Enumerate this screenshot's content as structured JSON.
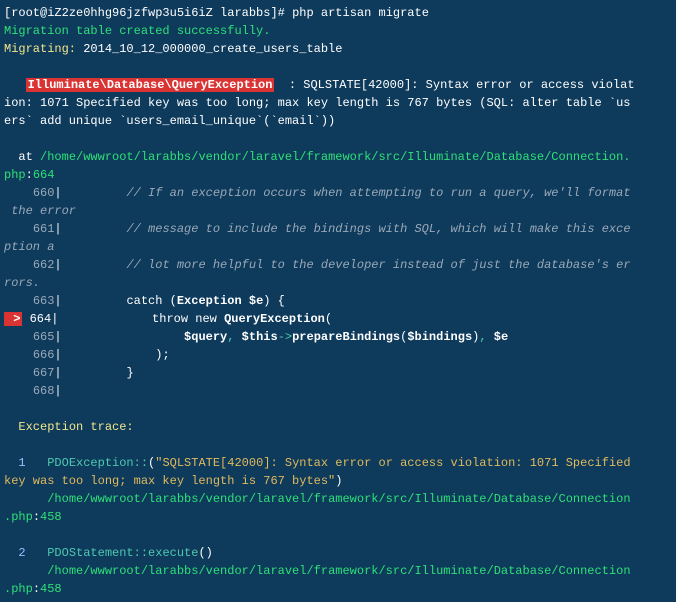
{
  "prompt": {
    "user_host": "root@iZ2ze0hhg96jzfwp3u5i6iZ",
    "path": "larabbs",
    "command": "php artisan migrate"
  },
  "messages": {
    "migration_created": "Migration table created successfully.",
    "migrating_label": "Migrating:",
    "migrating_file": "2014_10_12_000000_create_users_table"
  },
  "error": {
    "exception_class": "Illuminate\\Database\\QueryException",
    "colon": ":",
    "sqlstate_line1": "SQLSTATE[42000]: Syntax error or access violat",
    "sqlstate_line2": "ion: 1071 Specified key was too long; max key length is 767 bytes (SQL: alter table `us",
    "sqlstate_line3": "ers` add unique `users_email_unique`(`email`))"
  },
  "location": {
    "at": "at",
    "path": "/home/wwwroot/larabbs/vendor/laravel/framework/src/Illuminate/Database/Connection.",
    "php": "php",
    "line": "664"
  },
  "code": {
    "l660": {
      "num": "660",
      "text": "// If an exception occurs when attempting to run a query, we'll format"
    },
    "l660b": " the error",
    "l661": {
      "num": "661",
      "text": "// message to include the bindings with SQL, which will make this exce"
    },
    "l661b": "ption a",
    "l662": {
      "num": "662",
      "text": "// lot more helpful to the developer instead of just the database's er"
    },
    "l662b": "rors.",
    "l663": {
      "num": "663",
      "catch": "catch",
      "lparen": "(",
      "exc": "Exception",
      "var": "$e",
      "rparen": ") {"
    },
    "l664": {
      "arrow": " >",
      "num": "664",
      "throw": "throw new",
      "cls": "QueryException",
      "lparen": "("
    },
    "l665": {
      "num": "665",
      "q": "$query",
      "c1": ",",
      "this": "$this",
      "arrow2": "->",
      "prep": "prepareBindings",
      "lp": "(",
      "bind": "$bindings",
      "rp": ")",
      "c2": ",",
      "e": "$e"
    },
    "l666": {
      "num": "666",
      "text": ");"
    },
    "l667": {
      "num": "667",
      "text": "}"
    },
    "l668": {
      "num": "668"
    }
  },
  "trace": {
    "header": "Exception trace:",
    "t1": {
      "idx": "1",
      "cls": "PDOException::",
      "open": "(",
      "msg1": "\"SQLSTATE[42000]: Syntax error or access violation: 1071 Specified ",
      "msg2": "key was too long; max key length is 767 bytes\"",
      "close": ")",
      "path": "/home/wwwroot/larabbs/vendor/laravel/framework/src/Illuminate/Database/Connection",
      "php": ".php",
      "line": "458"
    },
    "t2": {
      "idx": "2",
      "cls": "PDOStatement::execute",
      "parens": "()",
      "path": "/home/wwwroot/larabbs/vendor/laravel/framework/src/Illuminate/Database/Connection",
      "php": ".php",
      "line": "458"
    }
  }
}
